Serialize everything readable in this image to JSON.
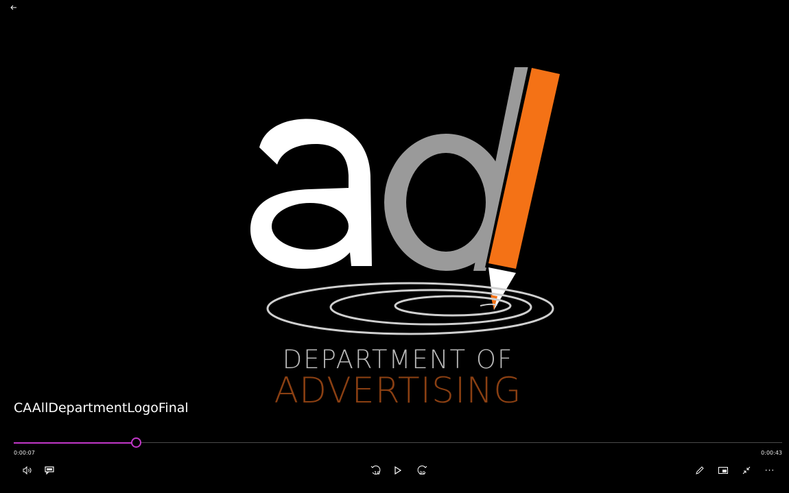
{
  "video": {
    "title": "CAAllDepartmentLogoFinal",
    "logo_line1": "DEPARTMENT OF",
    "logo_line2": "ADVERTISING",
    "logo_letters": "ad"
  },
  "playback": {
    "elapsed": "0:00:07",
    "total": "0:00:43",
    "progress": 0.1587
  },
  "controls": {
    "skip_back": "10",
    "skip_forward": "30",
    "more": "···"
  },
  "colors": {
    "accent": "#c238c9",
    "background": "#000000",
    "logo_white": "#ffffff",
    "logo_gray": "#999999",
    "pencil_orange": "#f47216",
    "dept_gray": "#b9b9b9",
    "advertising_brown": "#8a3f12"
  },
  "icons": {
    "back": "back-arrow-icon",
    "volume": "volume-icon",
    "captions": "captions-icon",
    "skip_back": "skip-back-10-icon",
    "play": "play-icon",
    "skip_forward": "skip-forward-30-icon",
    "edit": "pencil-edit-icon",
    "mini_view": "mini-view-icon",
    "exit_fullscreen": "exit-fullscreen-icon",
    "more": "more-options-icon"
  }
}
